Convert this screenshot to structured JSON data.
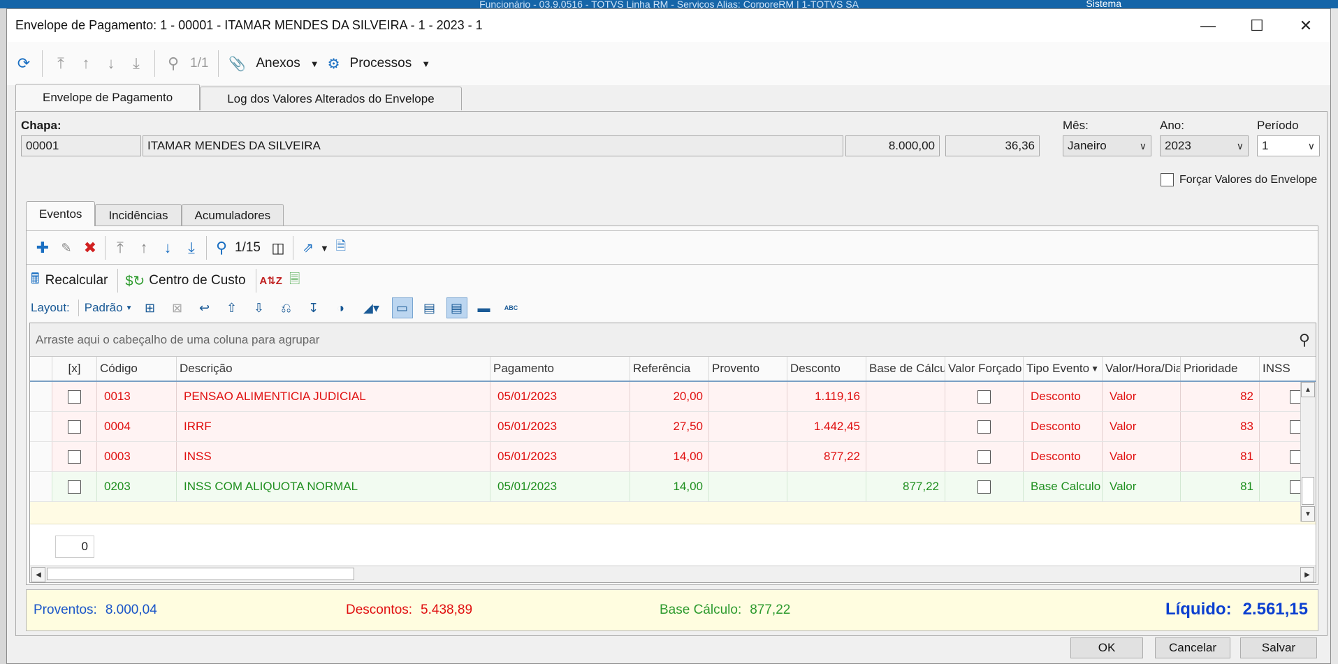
{
  "background": {
    "title": "Funcionário - 03.9.0516 - TOTVS Linha RM - Serviços  Alias: CorporeRM | 1-TOTVS SA",
    "sistema": "Sistema"
  },
  "window": {
    "title": "Envelope de Pagamento: 1 - 00001 - ITAMAR MENDES DA SILVEIRA - 1 - 2023 - 1"
  },
  "toolbar": {
    "record_counter": "1/1",
    "anexos_label": "Anexos",
    "processos_label": "Processos"
  },
  "outer_tabs": [
    {
      "label": "Envelope de Pagamento",
      "active": true
    },
    {
      "label": "Log dos Valores Alterados do Envelope",
      "active": false
    }
  ],
  "header": {
    "chapa_label": "Chapa:",
    "chapa_value": "00001",
    "nome_value": "ITAMAR MENDES DA SILVEIRA",
    "salario_value": "8.000,00",
    "horas_value": "36,36",
    "mes_label": "Mês:",
    "mes_value": "Janeiro",
    "ano_label": "Ano:",
    "ano_value": "2023",
    "periodo_label": "Período",
    "periodo_value": "1",
    "forcar_label": "Forçar Valores do Envelope"
  },
  "inner_tabs": [
    {
      "label": "Eventos",
      "active": true
    },
    {
      "label": "Incidências",
      "active": false
    },
    {
      "label": "Acumuladores",
      "active": false
    }
  ],
  "grid_toolbar": {
    "counter": "1/15",
    "recalcular_label": "Recalcular",
    "centro_custo_label": "Centro de Custo",
    "layout_label": "Layout:",
    "padrao_label": "Padrão"
  },
  "grid": {
    "group_hint": "Arraste aqui o cabeçalho de uma coluna para agrupar",
    "columns": [
      "[x]",
      "Código",
      "Descrição",
      "Pagamento",
      "Referência",
      "Provento",
      "Desconto",
      "Base de Cálculo",
      "Valor Forçado",
      "Tipo Evento",
      "Valor/Hora/Dia",
      "Prioridade",
      "INSS"
    ],
    "rows": [
      {
        "codigo": "0013",
        "descricao": "PENSAO ALIMENTICIA JUDICIAL",
        "pagamento": "05/01/2023",
        "referencia": "20,00",
        "provento": "",
        "desconto": "1.119,16",
        "base": "",
        "tipo": "Desconto",
        "vhd": "Valor",
        "prioridade": "82",
        "kind": "red"
      },
      {
        "codigo": "0004",
        "descricao": "IRRF",
        "pagamento": "05/01/2023",
        "referencia": "27,50",
        "provento": "",
        "desconto": "1.442,45",
        "base": "",
        "tipo": "Desconto",
        "vhd": "Valor",
        "prioridade": "83",
        "kind": "red"
      },
      {
        "codigo": "0003",
        "descricao": "INSS",
        "pagamento": "05/01/2023",
        "referencia": "14,00",
        "provento": "",
        "desconto": "877,22",
        "base": "",
        "tipo": "Desconto",
        "vhd": "Valor",
        "prioridade": "81",
        "kind": "red"
      },
      {
        "codigo": "0203",
        "descricao": "INSS COM ALIQUOTA NORMAL",
        "pagamento": "05/01/2023",
        "referencia": "14,00",
        "provento": "",
        "desconto": "",
        "base": "877,22",
        "tipo": "Base Calculo",
        "vhd": "Valor",
        "prioridade": "81",
        "kind": "green"
      }
    ],
    "footer_count": "0"
  },
  "totals": {
    "proventos_label": "Proventos:",
    "proventos_value": "8.000,04",
    "descontos_label": "Descontos:",
    "descontos_value": "5.438,89",
    "base_label": "Base Cálculo:",
    "base_value": "877,22",
    "liquido_label": "Líquido:",
    "liquido_value": "2.561,15"
  },
  "buttons": {
    "ok": "OK",
    "cancelar": "Cancelar",
    "salvar": "Salvar"
  },
  "colors": {
    "desconto": "#e01010",
    "base": "#1f8f1f",
    "proventos": "#1a55c8",
    "liquido": "#0b3fd0"
  }
}
